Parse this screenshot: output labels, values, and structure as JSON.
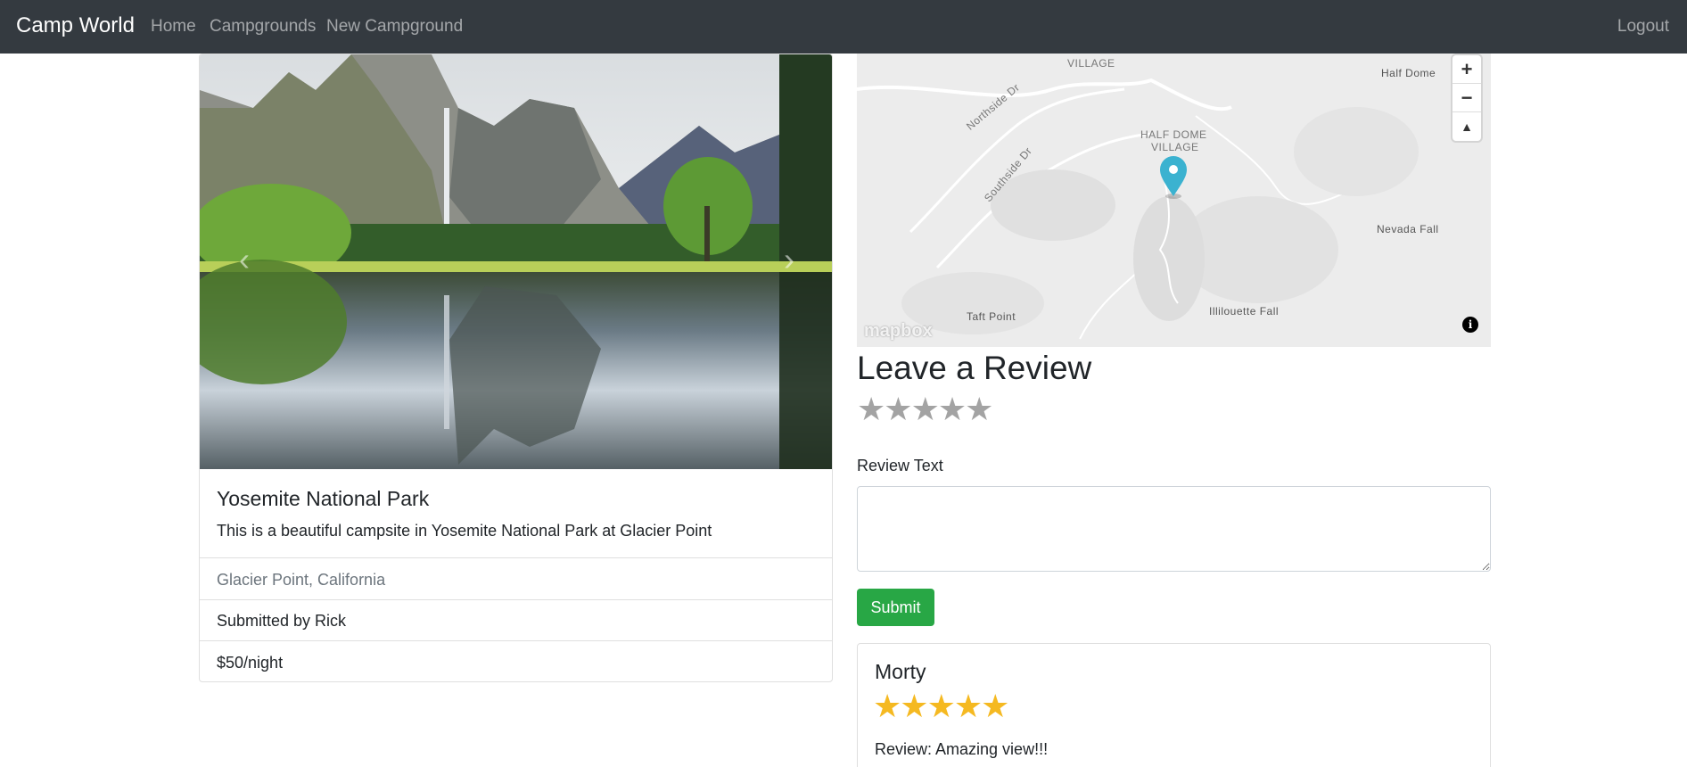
{
  "navbar": {
    "brand": "Camp World",
    "links": [
      {
        "label": "Home"
      },
      {
        "label": "Campgrounds"
      },
      {
        "label": "New Campground"
      }
    ],
    "logout": "Logout"
  },
  "campground": {
    "title": "Yosemite National Park",
    "description": "This is a beautiful campsite in Yosemite National Park at Glacier Point",
    "location": "Glacier Point, California",
    "submitted_by": "Submitted by Rick",
    "price": "$50/night",
    "carousel": {
      "prev_icon": "chevron-left-icon",
      "next_icon": "chevron-right-icon"
    }
  },
  "map": {
    "labels": {
      "village_top": "VILLAGE",
      "half_dome_village_1": "HALF DOME",
      "half_dome_village_2": "VILLAGE",
      "half_dome": "Half Dome",
      "northside": "Northside Dr",
      "southside": "Southside Dr",
      "nevada_fall": "Nevada Fall",
      "taft_point": "Taft Point",
      "illilouette_fall": "Illilouette Fall"
    },
    "zoom_in": "+",
    "zoom_out": "−",
    "compass": "▲",
    "logo": "mapbox",
    "info": "i",
    "marker_color": "#3bb2d0"
  },
  "review_form": {
    "heading": "Leave a Review",
    "label": "Review Text",
    "textarea_value": "",
    "submit": "Submit",
    "rating_max": 5,
    "rating_selected": 0
  },
  "reviews": [
    {
      "author": "Morty",
      "rating": 5,
      "text": "Review: Amazing view!!!"
    }
  ],
  "colors": {
    "navbar": "#343a40",
    "submit": "#28a745",
    "star_filled": "#f5b921",
    "star_empty": "#a3a3a3"
  }
}
